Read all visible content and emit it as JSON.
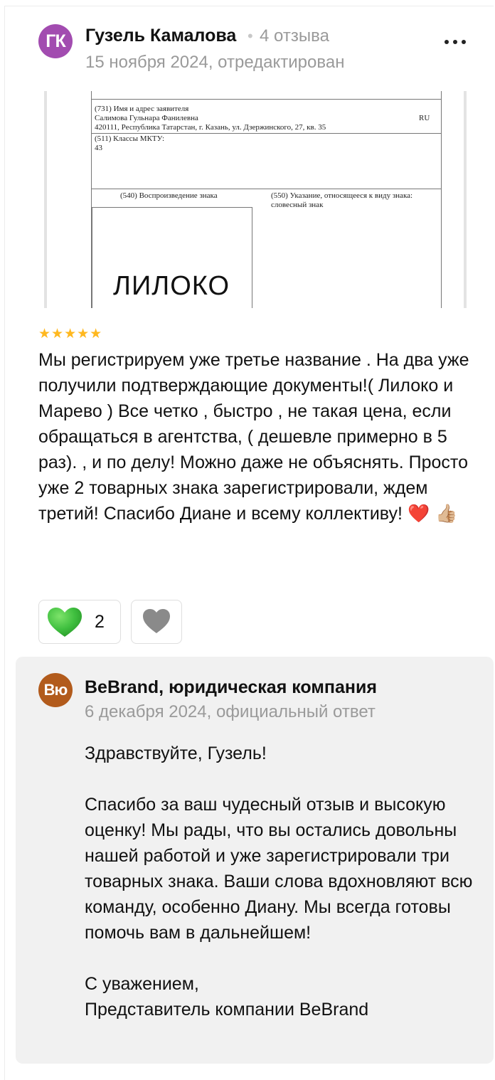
{
  "review": {
    "author_initials": "ГК",
    "author_name": "Гузель Камалова",
    "separator": "•",
    "review_count": "4 отзыва",
    "date": "15 ноября 2024, отредактирован",
    "rating": 5,
    "stars": "★★★★★",
    "photo": {
      "applicant_label": "(731) Имя и адрес заявителя",
      "applicant_name": "Салимова Гульнара Фанилевна",
      "country_code": "RU",
      "applicant_address": "420111, Республика Татарстан, г. Казань, ул. Дзержинского, 27, кв. 35",
      "classes_label": "(511) Классы МКТУ:",
      "classes_value": "43",
      "mark_reproduction_label": "(540) Воспроизведение знака",
      "mark_kind_label": "(550) Указание, относящееся к виду знака:",
      "mark_kind_value": "словесный знак",
      "mark_word": "ЛИЛОКО"
    },
    "text": "Мы регистрируем уже третье название . На два уже получили подтверждающие документы!( Лилоко и Марево ) Все четко , быстро , не такая цена, если обращаться в агентства, ( дешевле примерно в 5 раз). , и по делу! Можно даже не объяснять. Просто уже 2 товарных знака зарегистрировали, ждем третий! Спасибо Диане и всему коллективу!",
    "emoji": "❤️ 👍🏼",
    "likes": "2"
  },
  "reply": {
    "company_initials": "Вю",
    "company_name": "BeBrand, юридическая компания",
    "date": "6 декабря 2024, официальный ответ",
    "greeting": "Здравствуйте, Гузель!",
    "body": "Спасибо за ваш чудесный отзыв и высокую оценку! Мы рады, что вы остались довольны нашей работой и уже зарегистрировали три товарных знака. Ваши слова вдохновляют всю команду, особенно Диану. Мы всегда готовы помочь вам в дальнейшем!",
    "closing": "С уважением,",
    "signature": "Представитель компании BeBrand"
  },
  "colors": {
    "author_avatar": "#a24cb0",
    "company_avatar": "#b25b1c",
    "star": "#ffb81f",
    "like_heart": "#3fbf3f",
    "dislike_heart": "#8a8a8a",
    "muted_text": "#9a9a9a",
    "reply_background": "#f1f1f1"
  },
  "icons": {
    "more": "more-dots-icon",
    "like": "green-heart-icon",
    "dislike": "gray-heart-icon"
  }
}
